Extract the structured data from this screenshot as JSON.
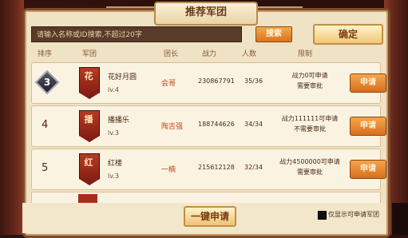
{
  "title": "推荐军团",
  "search": {
    "placeholder": "请输入名称或ID搜索,不超过20字",
    "search_label": "搜索",
    "confirm_label": "确定"
  },
  "columns": [
    "排序",
    "军团",
    "团长",
    "战力",
    "人数",
    "限制"
  ],
  "rows": [
    {
      "rank": "3",
      "banner_char": "花",
      "name": "花好月圆",
      "level": "lv.4",
      "leader": "会哥",
      "power": "230867791",
      "members": "35/36",
      "limit_line1": "战力0可申请",
      "limit_line2": "需要审批",
      "apply_label": "申请"
    },
    {
      "rank": "4",
      "banner_char": "播",
      "name": "播播乐",
      "level": "lv.3",
      "leader": "陶吉强",
      "power": "188744626",
      "members": "34/34",
      "limit_line1": "战力111111可申请",
      "limit_line2": "不需要审批",
      "apply_label": "申请"
    },
    {
      "rank": "5",
      "banner_char": "红",
      "name": "红楼",
      "level": "lv.3",
      "leader": "一楠",
      "power": "215612128",
      "members": "32/34",
      "limit_line1": "战力4500000可申请",
      "limit_line2": "需要审批",
      "apply_label": "申请"
    }
  ],
  "bottom": {
    "oneclick_label": "一键申请",
    "checkbox_label": "仅显示可申请军团"
  }
}
